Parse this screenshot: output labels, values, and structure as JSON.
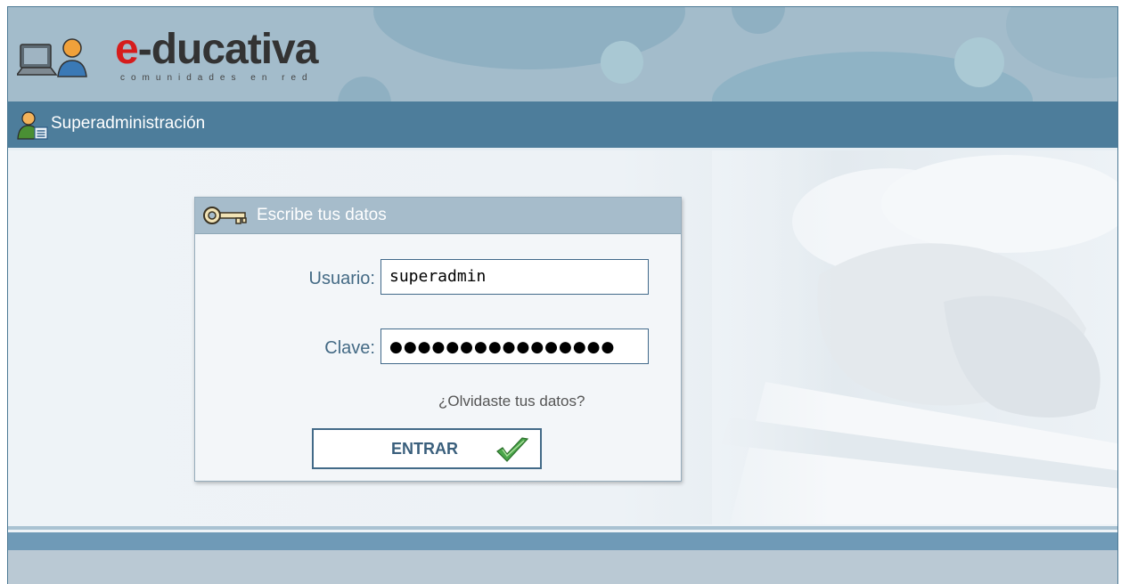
{
  "header": {
    "logo_prefix": "e",
    "logo_rest": "-ducativa",
    "logo_tagline": "comunidades en red"
  },
  "titlebar": {
    "title": "Superadministración"
  },
  "login": {
    "heading": "Escribe tus datos",
    "username_label": "Usuario:",
    "username_value": "superadmin",
    "password_label": "Clave:",
    "password_mask": "●●●●●●●●●●●●●●●●",
    "forgot_link": "¿Olvidaste tus datos?",
    "submit_label": "ENTRAR"
  },
  "icons": {
    "logo": "computer-and-person-icon",
    "title": "admin-user-icon",
    "heading": "key-icon",
    "submit": "checkmark-icon"
  },
  "colors": {
    "header_bg": "#a3bccb",
    "titlebar_bg": "#4d7d9b",
    "logo_red": "#d61c1c",
    "label_blue": "#446a85"
  }
}
